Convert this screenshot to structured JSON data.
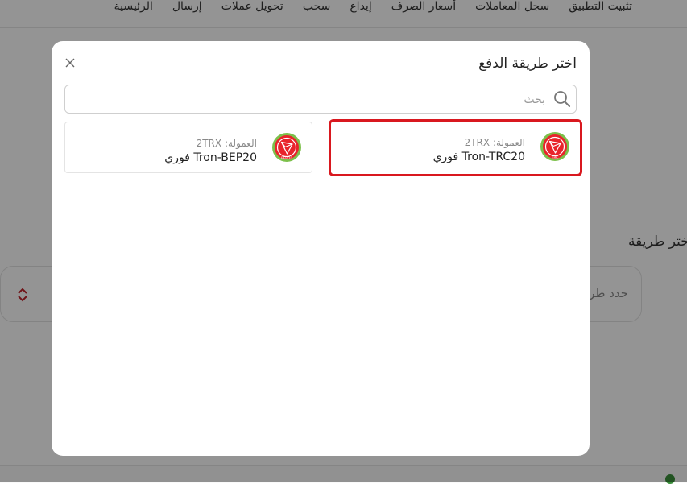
{
  "nav": {
    "items": [
      "الرئيسية",
      "إرسال",
      "تحويل عملات",
      "سحب",
      "إيداع",
      "أسعار الصرف",
      "سجل المعاملات",
      "تثبيت التطبيق"
    ]
  },
  "background": {
    "section_label": "إختر طريقة",
    "select_placeholder": "حدد طر"
  },
  "modal": {
    "title": "اختر طريقة الدفع",
    "close_icon": "close-icon",
    "search": {
      "placeholder": "بحث",
      "value": "",
      "icon": "search-icon"
    },
    "methods": [
      {
        "fee_label": "العمولة:",
        "fee_value": "2TRX",
        "name": "Tron-TRC20 فوري",
        "logo_text": "TRC",
        "selected": true
      },
      {
        "fee_label": "العمولة:",
        "fee_value": "2TRX",
        "name": "Tron-BEP20 فوري",
        "logo_text": "BEP 20",
        "selected": false
      }
    ]
  },
  "colors": {
    "accent_red": "#d9181f",
    "logo_ring": "#7cc04b",
    "overlay": "rgba(0,0,0,0.42)"
  }
}
